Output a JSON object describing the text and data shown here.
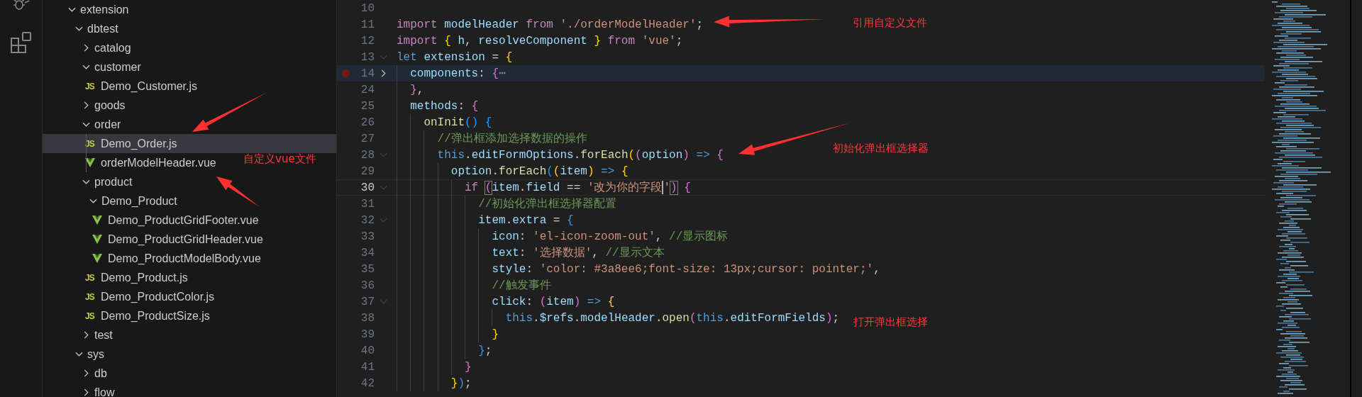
{
  "explorer": {
    "tree": [
      {
        "kind": "folder",
        "name": "extension",
        "expanded": true,
        "selected": false,
        "children": [
          {
            "kind": "folder",
            "name": "dbtest",
            "expanded": true,
            "selected": false,
            "children": [
              {
                "kind": "folder",
                "name": "catalog",
                "expanded": false,
                "selected": false
              },
              {
                "kind": "folder",
                "name": "customer",
                "expanded": true,
                "selected": false,
                "children": [
                  {
                    "kind": "js",
                    "icon_text": "JS",
                    "name": "Demo_Customer.js",
                    "selected": false
                  }
                ]
              },
              {
                "kind": "folder",
                "name": "goods",
                "expanded": false,
                "selected": false
              },
              {
                "kind": "folder",
                "name": "order",
                "expanded": true,
                "selected": false,
                "children": [
                  {
                    "kind": "js",
                    "icon_text": "JS",
                    "name": "Demo_Order.js",
                    "selected": true
                  },
                  {
                    "kind": "vue",
                    "name": "orderModelHeader.vue",
                    "selected": false
                  }
                ]
              },
              {
                "kind": "folder",
                "name": "product",
                "expanded": true,
                "selected": false,
                "children": [
                  {
                    "kind": "folder",
                    "name": "Demo_Product",
                    "expanded": true,
                    "selected": false,
                    "children": [
                      {
                        "kind": "vue",
                        "name": "Demo_ProductGridFooter.vue",
                        "selected": false
                      },
                      {
                        "kind": "vue",
                        "name": "Demo_ProductGridHeader.vue",
                        "selected": false
                      },
                      {
                        "kind": "vue",
                        "name": "Demo_ProductModelBody.vue",
                        "selected": false
                      }
                    ]
                  },
                  {
                    "kind": "js",
                    "icon_text": "JS",
                    "name": "Demo_Product.js",
                    "selected": false
                  },
                  {
                    "kind": "js",
                    "icon_text": "JS",
                    "name": "Demo_ProductColor.js",
                    "selected": false
                  },
                  {
                    "kind": "js",
                    "icon_text": "JS",
                    "name": "Demo_ProductSize.js",
                    "selected": false
                  }
                ]
              },
              {
                "kind": "folder",
                "name": "test",
                "expanded": false,
                "selected": false
              }
            ]
          },
          {
            "kind": "folder",
            "name": "sys",
            "expanded": true,
            "selected": false,
            "children": [
              {
                "kind": "folder",
                "name": "db",
                "expanded": false,
                "selected": false
              },
              {
                "kind": "folder",
                "name": "flow",
                "expanded": false,
                "selected": false
              }
            ]
          }
        ]
      }
    ]
  },
  "editor": {
    "lines": [
      {
        "number": "10",
        "breakpoint": false,
        "fold_marker": false,
        "highlighted": false,
        "current": false
      },
      {
        "number": "11",
        "breakpoint": false,
        "fold_marker": false,
        "highlighted": false,
        "current": false,
        "tokens": [
          {
            "kind": "kw",
            "text": "import"
          },
          {
            "kind": "v",
            "text": " modelHeader "
          },
          {
            "kind": "kw",
            "text": "from"
          },
          {
            "kind": "s",
            "text": " './orderModelHeader'"
          },
          {
            "kind": "p",
            "text": ";"
          }
        ]
      },
      {
        "number": "12",
        "breakpoint": false,
        "fold_marker": false,
        "highlighted": false,
        "current": false,
        "tokens": [
          {
            "kind": "kw",
            "text": "import"
          },
          {
            "kind": "b1",
            "text": " {"
          },
          {
            "kind": "v",
            "text": " h, resolveComponent "
          },
          {
            "kind": "b1",
            "text": "}"
          },
          {
            "kind": "kw",
            "text": " from"
          },
          {
            "kind": "s",
            "text": " 'vue'"
          },
          {
            "kind": "p",
            "text": ";"
          }
        ]
      },
      {
        "number": "13",
        "breakpoint": false,
        "fold_marker": true,
        "folded": false,
        "highlighted": false,
        "current": false,
        "tokens": [
          {
            "kind": "st",
            "text": "let"
          },
          {
            "kind": "v",
            "text": " extension"
          },
          {
            "kind": "p",
            "text": " = "
          },
          {
            "kind": "b1",
            "text": "{"
          }
        ]
      },
      {
        "number": "14",
        "breakpoint": true,
        "fold_marker": true,
        "folded": true,
        "highlighted": true,
        "current": false,
        "tokens": [
          {
            "kind": "v",
            "text": "  components"
          },
          {
            "kind": "p",
            "text": ": "
          },
          {
            "kind": "b2",
            "text": "{"
          },
          {
            "kind": "f",
            "text": "⋯"
          }
        ]
      },
      {
        "number": "24",
        "breakpoint": false,
        "fold_marker": false,
        "highlighted": false,
        "current": false,
        "tokens": [
          {
            "kind": "b2",
            "text": "  }"
          },
          {
            "kind": "p",
            "text": ","
          }
        ]
      },
      {
        "number": "25",
        "breakpoint": false,
        "fold_marker": false,
        "highlighted": false,
        "current": false,
        "tokens": [
          {
            "kind": "v",
            "text": "  methods"
          },
          {
            "kind": "p",
            "text": ": "
          },
          {
            "kind": "b2",
            "text": "{"
          }
        ]
      },
      {
        "number": "26",
        "breakpoint": false,
        "fold_marker": false,
        "highlighted": false,
        "current": false,
        "tokens": [
          {
            "kind": "fn",
            "text": "    onInit"
          },
          {
            "kind": "b3",
            "text": "()"
          },
          {
            "kind": "b3",
            "text": " {"
          }
        ]
      },
      {
        "number": "27",
        "breakpoint": false,
        "fold_marker": false,
        "highlighted": false,
        "current": false,
        "tokens": [
          {
            "kind": "c",
            "text": "      //弹出框添加选择数据的操作"
          }
        ]
      },
      {
        "number": "28",
        "breakpoint": false,
        "fold_marker": true,
        "folded": false,
        "highlighted": false,
        "current": false,
        "tokens": [
          {
            "kind": "st",
            "text": "      this"
          },
          {
            "kind": "p",
            "text": "."
          },
          {
            "kind": "v",
            "text": "editFormOptions"
          },
          {
            "kind": "p",
            "text": "."
          },
          {
            "kind": "fn",
            "text": "forEach"
          },
          {
            "kind": "b1",
            "text": "("
          },
          {
            "kind": "b2",
            "text": "("
          },
          {
            "kind": "v",
            "text": "option"
          },
          {
            "kind": "b2",
            "text": ")"
          },
          {
            "kind": "st",
            "text": " => "
          },
          {
            "kind": "b2",
            "text": "{"
          }
        ]
      },
      {
        "number": "29",
        "breakpoint": false,
        "fold_marker": false,
        "highlighted": false,
        "current": false,
        "tokens": [
          {
            "kind": "v",
            "text": "        option"
          },
          {
            "kind": "p",
            "text": "."
          },
          {
            "kind": "fn",
            "text": "forEach"
          },
          {
            "kind": "b3",
            "text": "("
          },
          {
            "kind": "b1",
            "text": "("
          },
          {
            "kind": "v",
            "text": "item"
          },
          {
            "kind": "b1",
            "text": ")"
          },
          {
            "kind": "st",
            "text": " => "
          },
          {
            "kind": "b1",
            "text": "{"
          }
        ]
      },
      {
        "number": "30",
        "breakpoint": false,
        "fold_marker": true,
        "folded": false,
        "highlighted": false,
        "current": true,
        "tokens": [
          {
            "kind": "kw",
            "text": "          if "
          },
          {
            "kind": "bm",
            "text": "("
          },
          {
            "kind": "v",
            "text": "item"
          },
          {
            "kind": "p",
            "text": "."
          },
          {
            "kind": "v",
            "text": "field"
          },
          {
            "kind": "p",
            "text": " == "
          },
          {
            "kind": "s",
            "text": "'改为你的字段",
            "cursor_after": true
          },
          {
            "kind": "s",
            "text": "'"
          },
          {
            "kind": "bm",
            "text": ")"
          },
          {
            "kind": "b2",
            "text": " {"
          }
        ]
      },
      {
        "number": "31",
        "breakpoint": false,
        "fold_marker": false,
        "highlighted": false,
        "current": false,
        "tokens": [
          {
            "kind": "c",
            "text": "            //初始化弹出框选择器配置"
          }
        ]
      },
      {
        "number": "32",
        "breakpoint": false,
        "fold_marker": true,
        "folded": false,
        "highlighted": false,
        "current": false,
        "tokens": [
          {
            "kind": "v",
            "text": "            item"
          },
          {
            "kind": "p",
            "text": "."
          },
          {
            "kind": "v",
            "text": "extra"
          },
          {
            "kind": "p",
            "text": " = "
          },
          {
            "kind": "b3",
            "text": "{"
          }
        ]
      },
      {
        "number": "33",
        "breakpoint": false,
        "fold_marker": false,
        "highlighted": false,
        "current": false,
        "tokens": [
          {
            "kind": "v",
            "text": "              icon"
          },
          {
            "kind": "p",
            "text": ": "
          },
          {
            "kind": "s",
            "text": "'el-icon-zoom-out'"
          },
          {
            "kind": "p",
            "text": ", "
          },
          {
            "kind": "c",
            "text": "//显示图标"
          }
        ]
      },
      {
        "number": "34",
        "breakpoint": false,
        "fold_marker": false,
        "highlighted": false,
        "current": false,
        "tokens": [
          {
            "kind": "v",
            "text": "              text"
          },
          {
            "kind": "p",
            "text": ": "
          },
          {
            "kind": "s",
            "text": "'选择数据'"
          },
          {
            "kind": "p",
            "text": ", "
          },
          {
            "kind": "c",
            "text": "//显示文本"
          }
        ]
      },
      {
        "number": "35",
        "breakpoint": false,
        "fold_marker": false,
        "highlighted": false,
        "current": false,
        "tokens": [
          {
            "kind": "v",
            "text": "              style"
          },
          {
            "kind": "p",
            "text": ": "
          },
          {
            "kind": "s",
            "text": "'color: #3a8ee6;font-size: 13px;cursor: pointer;'"
          },
          {
            "kind": "p",
            "text": ","
          }
        ]
      },
      {
        "number": "36",
        "breakpoint": false,
        "fold_marker": false,
        "highlighted": false,
        "current": false,
        "tokens": [
          {
            "kind": "c",
            "text": "              //触发事件"
          }
        ]
      },
      {
        "number": "37",
        "breakpoint": false,
        "fold_marker": true,
        "folded": false,
        "highlighted": false,
        "current": false,
        "tokens": [
          {
            "kind": "v",
            "text": "              click"
          },
          {
            "kind": "p",
            "text": ": "
          },
          {
            "kind": "b2",
            "text": "("
          },
          {
            "kind": "v",
            "text": "item"
          },
          {
            "kind": "b2",
            "text": ")"
          },
          {
            "kind": "st",
            "text": " => "
          },
          {
            "kind": "b1",
            "text": "{"
          }
        ]
      },
      {
        "number": "38",
        "breakpoint": false,
        "fold_marker": false,
        "highlighted": false,
        "current": false,
        "tokens": [
          {
            "kind": "st",
            "text": "                this"
          },
          {
            "kind": "p",
            "text": "."
          },
          {
            "kind": "v",
            "text": "$refs"
          },
          {
            "kind": "p",
            "text": "."
          },
          {
            "kind": "v",
            "text": "modelHeader"
          },
          {
            "kind": "p",
            "text": "."
          },
          {
            "kind": "fn",
            "text": "open"
          },
          {
            "kind": "b2",
            "text": "("
          },
          {
            "kind": "st",
            "text": "this"
          },
          {
            "kind": "p",
            "text": "."
          },
          {
            "kind": "v",
            "text": "editFormFields"
          },
          {
            "kind": "b2",
            "text": ")"
          },
          {
            "kind": "p",
            "text": ";"
          }
        ]
      },
      {
        "number": "39",
        "breakpoint": false,
        "fold_marker": false,
        "highlighted": false,
        "current": false,
        "tokens": [
          {
            "kind": "b1",
            "text": "              }"
          }
        ]
      },
      {
        "number": "40",
        "breakpoint": false,
        "fold_marker": false,
        "highlighted": false,
        "current": false,
        "tokens": [
          {
            "kind": "b3",
            "text": "            }"
          },
          {
            "kind": "p",
            "text": ";"
          }
        ]
      },
      {
        "number": "41",
        "breakpoint": false,
        "fold_marker": false,
        "highlighted": false,
        "current": false,
        "tokens": [
          {
            "kind": "b2",
            "text": "          }"
          }
        ]
      },
      {
        "number": "42",
        "breakpoint": false,
        "fold_marker": false,
        "highlighted": false,
        "current": false,
        "tokens": [
          {
            "kind": "b1",
            "text": "        }"
          },
          {
            "kind": "b3",
            "text": ")"
          },
          {
            "kind": "p",
            "text": ";"
          }
        ]
      }
    ]
  },
  "annotations": [
    {
      "text": "引用自定义文件"
    },
    {
      "text": "初始化弹出框选择器"
    },
    {
      "text": "自定义vue文件"
    },
    {
      "text": "打开弹出框选择"
    }
  ]
}
